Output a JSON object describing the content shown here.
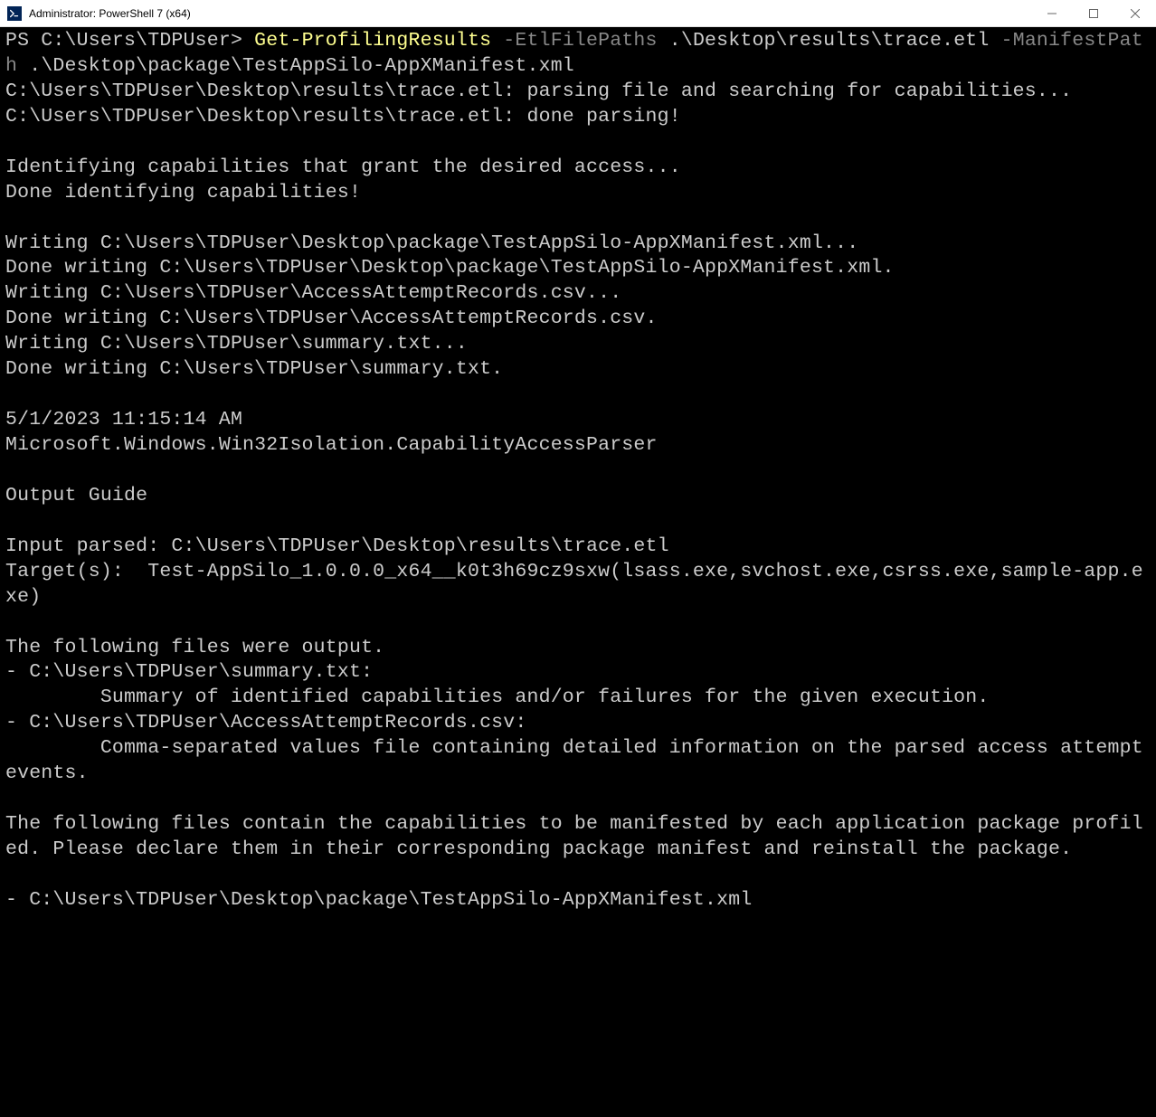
{
  "window": {
    "title": "Administrator: PowerShell 7 (x64)",
    "icon_label": "PS"
  },
  "terminal": {
    "prompt": "PS C:\\Users\\TDPUser> ",
    "cmd_name": "Get-ProfilingResults",
    "param1_name": " -EtlFilePaths",
    "param1_value": " .\\Desktop\\results\\trace.etl ",
    "param2_name": "-ManifestPath",
    "param2_value": " .\\Desktop\\package\\TestAppSilo-AppXManifest.xml",
    "output": "C:\\Users\\TDPUser\\Desktop\\results\\trace.etl: parsing file and searching for capabilities...\nC:\\Users\\TDPUser\\Desktop\\results\\trace.etl: done parsing!\n\nIdentifying capabilities that grant the desired access...\nDone identifying capabilities!\n\nWriting C:\\Users\\TDPUser\\Desktop\\package\\TestAppSilo-AppXManifest.xml...\nDone writing C:\\Users\\TDPUser\\Desktop\\package\\TestAppSilo-AppXManifest.xml.\nWriting C:\\Users\\TDPUser\\AccessAttemptRecords.csv...\nDone writing C:\\Users\\TDPUser\\AccessAttemptRecords.csv.\nWriting C:\\Users\\TDPUser\\summary.txt...\nDone writing C:\\Users\\TDPUser\\summary.txt.\n\n5/1/2023 11:15:14 AM\nMicrosoft.Windows.Win32Isolation.CapabilityAccessParser\n\nOutput Guide\n\nInput parsed: C:\\Users\\TDPUser\\Desktop\\results\\trace.etl\nTarget(s):  Test-AppSilo_1.0.0.0_x64__k0t3h69cz9sxw(lsass.exe,svchost.exe,csrss.exe,sample-app.exe)\n\nThe following files were output.\n- C:\\Users\\TDPUser\\summary.txt:\n        Summary of identified capabilities and/or failures for the given execution.\n- C:\\Users\\TDPUser\\AccessAttemptRecords.csv:\n        Comma-separated values file containing detailed information on the parsed access attempt events.\n\nThe following files contain the capabilities to be manifested by each application package profiled. Please declare them in their corresponding package manifest and reinstall the package.\n\n- C:\\Users\\TDPUser\\Desktop\\package\\TestAppSilo-AppXManifest.xml"
  }
}
